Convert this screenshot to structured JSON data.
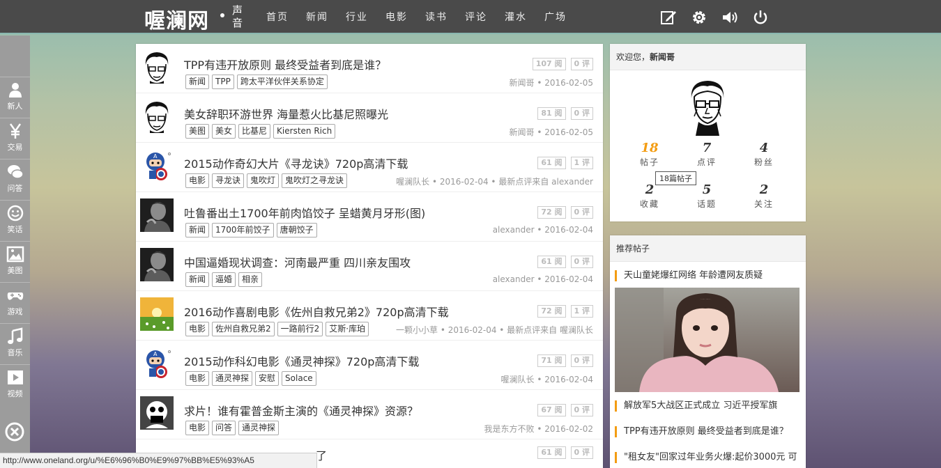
{
  "brand": {
    "logo": "喔澜网",
    "sub": "声音"
  },
  "nav": [
    "首页",
    "新闻",
    "行业",
    "电影",
    "读书",
    "评论",
    "灌水",
    "广场"
  ],
  "top_icons": [
    "edit-icon",
    "gear-icon",
    "volume-icon",
    "power-icon"
  ],
  "sidebar": [
    {
      "label": "新人",
      "icon": "user-icon"
    },
    {
      "label": "交易",
      "icon": "yen-icon"
    },
    {
      "label": "问答",
      "icon": "chat-icon"
    },
    {
      "label": "笑话",
      "icon": "smile-icon"
    },
    {
      "label": "美图",
      "icon": "image-icon"
    },
    {
      "label": "游戏",
      "icon": "gamepad-icon"
    },
    {
      "label": "音乐",
      "icon": "music-icon"
    },
    {
      "label": "视频",
      "icon": "video-icon"
    }
  ],
  "posts": [
    {
      "title": "TPP有违开放原则 最终受益者到底是谁？",
      "tags": [
        "新闻",
        "TPP",
        "跨太平洋伙伴关系协定"
      ],
      "views": "107 阅",
      "comments": "0 评",
      "meta": "新闻哥 • 2016-02-05",
      "avatar": "sketch"
    },
    {
      "title": "美女辞职环游世界 海量惹火比基尼照曝光",
      "tags": [
        "美图",
        "美女",
        "比基尼",
        "Kiersten Rich"
      ],
      "views": "81 阅",
      "comments": "0 评",
      "meta": "新闻哥 • 2016-02-05",
      "avatar": "sketch"
    },
    {
      "title": "2015动作奇幻大片《寻龙诀》720p高清下载",
      "tags": [
        "电影",
        "寻龙诀",
        "鬼吹灯",
        "鬼吹灯之寻龙诀"
      ],
      "views": "61 阅",
      "comments": "1 评",
      "meta": "喔澜队长 • 2016-02-04 • 最新点评来自 alexander",
      "avatar": "captain"
    },
    {
      "title": "吐鲁番出土1700年前肉馅饺子 呈蜡黄月牙形(图)",
      "tags": [
        "新闻",
        "1700年前饺子",
        "唐朝饺子"
      ],
      "views": "72 阅",
      "comments": "0 评",
      "meta": "alexander • 2016-02-04",
      "avatar": "photo"
    },
    {
      "title": "中国逼婚现状调查：河南最严重 四川亲友围攻",
      "tags": [
        "新闻",
        "逼婚",
        "相亲"
      ],
      "views": "61 阅",
      "comments": "0 评",
      "meta": "alexander • 2016-02-04",
      "avatar": "photo"
    },
    {
      "title": "2016动作喜剧电影《佐州自救兄弟2》720p高清下载",
      "tags": [
        "电影",
        "佐州自救兄弟2",
        "一路前行2",
        "艾斯·库珀"
      ],
      "views": "72 阅",
      "comments": "1 评",
      "meta": "一颗小小草 • 2016-02-04 • 最新点评来自 喔澜队长",
      "avatar": "field"
    },
    {
      "title": "2015动作科幻电影《通灵神探》720p高清下载",
      "tags": [
        "电影",
        "通灵神探",
        "安慰",
        "Solace"
      ],
      "views": "71 阅",
      "comments": "0 评",
      "meta": "喔澜队长 • 2016-02-04",
      "avatar": "captain"
    },
    {
      "title": "求片！谁有霍普金斯主演的《通灵神探》资源？",
      "tags": [
        "电影",
        "问答",
        "通灵神探"
      ],
      "views": "67 阅",
      "comments": "0 评",
      "meta": "我是东方不败 • 2016-02-02",
      "avatar": "cartoon"
    },
    {
      "title": "了",
      "tags": [],
      "views": "61 阅",
      "comments": "0 评",
      "meta": "",
      "avatar": "none"
    }
  ],
  "user": {
    "welcome": "欢迎您，",
    "name": "新闻哥",
    "stats": [
      {
        "n": "18",
        "l": "帖子"
      },
      {
        "n": "7",
        "l": "点评"
      },
      {
        "n": "4",
        "l": "粉丝"
      },
      {
        "n": "2",
        "l": "收藏"
      },
      {
        "n": "5",
        "l": "话题"
      },
      {
        "n": "2",
        "l": "关注"
      }
    ],
    "tooltip": "18篇帖子"
  },
  "recommend": {
    "title": "推荐帖子",
    "items": [
      "天山童姥爆红网络 年龄遭网友质疑",
      "解放军5大战区正式成立 习近平授军旗",
      "TPP有违开放原则 最终受益者到底是谁？",
      "\"租女友\"回家过年业务火爆:起价3000元 可"
    ]
  },
  "status_url": "http://www.oneland.org/u/%E6%96%B0%E9%97%BB%E5%93%A5",
  "colors": {
    "accent": "#f39c12",
    "topbar": "#4a4a4a",
    "sidebar": "#9c9c9c"
  }
}
